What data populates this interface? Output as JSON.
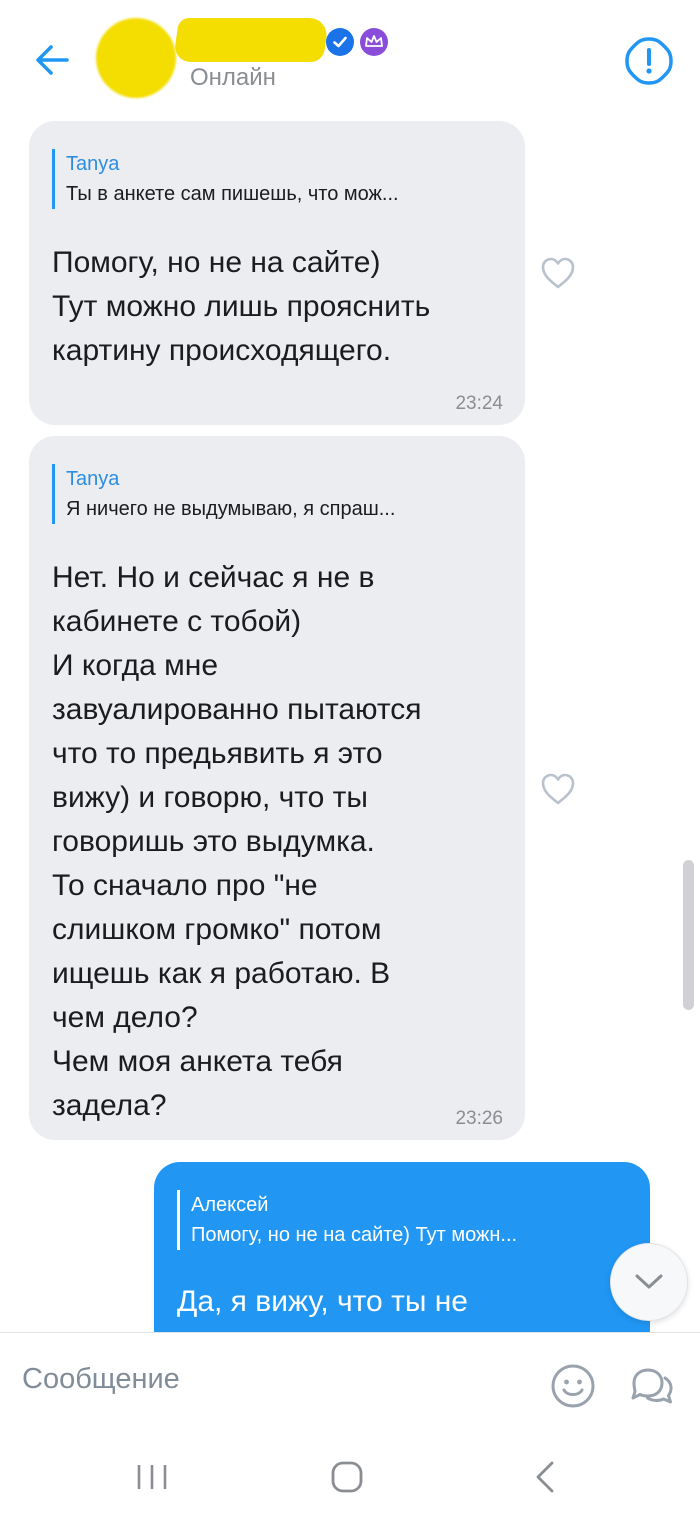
{
  "header": {
    "status": "Онлайн",
    "back_icon": "arrow-left-icon",
    "report_icon": "exclamation-circle-icon",
    "accent_color": "#2196f3"
  },
  "messages": [
    {
      "direction": "incoming",
      "quote_author": "Tanya",
      "quote_text": "Ты в анкете сам пишешь, что мож...",
      "text": "Помогу, но не на сайте)\nТут можно лишь прояснить\nкартину происходящего.",
      "time": "23:24"
    },
    {
      "direction": "incoming",
      "quote_author": "Tanya",
      "quote_text": "Я ничего не выдумываю, я спраш...",
      "text": "Нет. Но и сейчас я не в\nкабинете с тобой)\nИ когда мне\nзавуалированно пытаются\nчто то предьявить я это\nвижу) и говорю, что ты\nговоришь это выдумка.\nТо сначало про \"не\nслишком громко\" потом\nищешь как я работаю. В\nчем дело?\nЧем моя анкета тебя\nзадела?",
      "time": "23:26"
    },
    {
      "direction": "outgoing",
      "quote_author": "Алексей",
      "quote_text": "Помогу, но не на сайте) Тут можн...",
      "text": "Да, я вижу, что ты не"
    }
  ],
  "composer": {
    "placeholder": "Сообщение"
  },
  "colors": {
    "incoming_bubble": "#ebedf0",
    "outgoing_bubble": "#2196f3",
    "redaction": "#f4dd00"
  }
}
